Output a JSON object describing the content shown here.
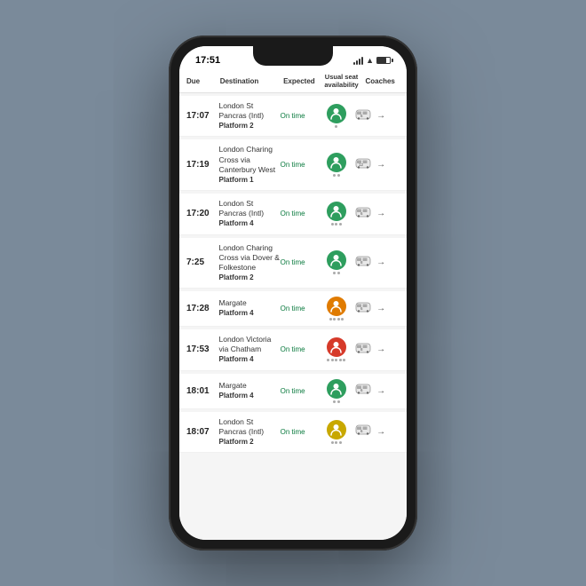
{
  "statusBar": {
    "time": "17:51",
    "batteryLevel": "70"
  },
  "tableHeader": {
    "due": "Due",
    "destination": "Destination",
    "expected": "Expected",
    "seatAvail": "Usual seat availability",
    "coaches": "Coaches"
  },
  "trains": [
    {
      "id": "t1",
      "time": "17:07",
      "destination": "London St Pancras (Intl)",
      "platform": "Platform 2",
      "expected": "On time",
      "seatColor": "green",
      "seatDots": 1,
      "coachNum": "6",
      "coachColor": "navy"
    },
    {
      "id": "t2",
      "time": "17:19",
      "destination": "London Charing Cross via Canterbury West",
      "platform": "Platform 1",
      "expected": "On time",
      "seatColor": "green",
      "seatDots": 2,
      "coachNum": "12",
      "coachColor": "navy"
    },
    {
      "id": "t3",
      "time": "17:20",
      "destination": "London St Pancras (Intl)",
      "platform": "Platform 4",
      "expected": "On time",
      "seatColor": "green",
      "seatDots": 3,
      "coachNum": "6",
      "coachColor": "navy"
    },
    {
      "id": "t4",
      "time": "7:25",
      "destination": "London Charing Cross via Dover & Folkestone",
      "platform": "Platform 2",
      "expected": "On time",
      "seatColor": "green",
      "seatDots": 2,
      "coachNum": "8",
      "coachColor": "navy"
    },
    {
      "id": "t5",
      "time": "17:28",
      "destination": "Margate",
      "platform": "Platform 4",
      "expected": "On time",
      "seatColor": "orange",
      "seatDots": 4,
      "coachNum": "6",
      "coachColor": "navy"
    },
    {
      "id": "t6",
      "time": "17:53",
      "destination": "London Victoria via Chatham",
      "platform": "Platform 4",
      "expected": "On time",
      "seatColor": "red",
      "seatDots": 5,
      "coachNum": "8",
      "coachColor": "navy"
    },
    {
      "id": "t7",
      "time": "18:01",
      "destination": "Margate",
      "platform": "Platform 4",
      "expected": "On time",
      "seatColor": "green",
      "seatDots": 2,
      "coachNum": "6",
      "coachColor": "navy"
    },
    {
      "id": "t8",
      "time": "18:07",
      "destination": "London St Pancras (Intl)",
      "platform": "Platform 2",
      "expected": "On time",
      "seatColor": "yellow",
      "seatDots": 3,
      "coachNum": "6",
      "coachColor": "navy"
    }
  ]
}
